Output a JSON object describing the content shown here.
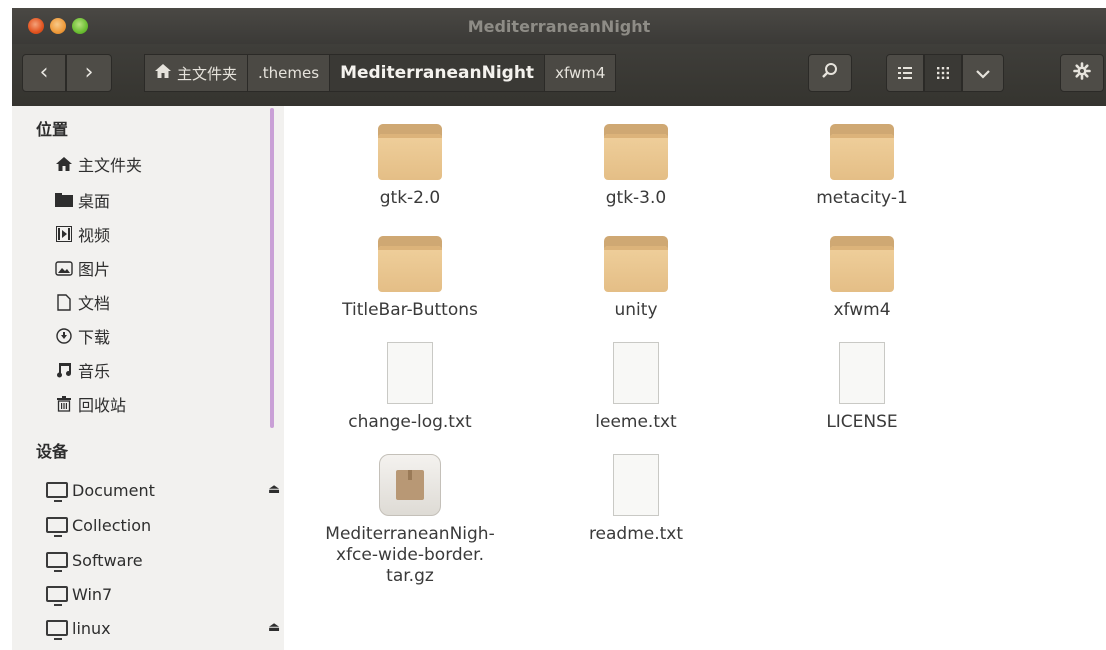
{
  "window": {
    "title": "MediterraneanNight"
  },
  "toolbar": {
    "back_glyph": "‹",
    "forward_glyph": "›",
    "breadcrumbs": [
      {
        "label": "主文件夹",
        "icon": "home-icon"
      },
      {
        "label": ".themes"
      },
      {
        "label": "MediterraneanNight",
        "active": true
      },
      {
        "label": "xfwm4"
      }
    ],
    "icons": [
      "search-icon",
      "list-view-icon",
      "grid-view-icon",
      "chevron-down-icon",
      "gear-icon"
    ]
  },
  "sidebar": {
    "places_header": "位置",
    "places": [
      {
        "label": "主文件夹",
        "icon": "home-icon"
      },
      {
        "label": "桌面",
        "icon": "desktop-folder-icon"
      },
      {
        "label": "视频",
        "icon": "video-icon"
      },
      {
        "label": "图片",
        "icon": "picture-icon"
      },
      {
        "label": "文档",
        "icon": "document-icon"
      },
      {
        "label": "下载",
        "icon": "download-icon"
      },
      {
        "label": "音乐",
        "icon": "music-icon"
      },
      {
        "label": "回收站",
        "icon": "trash-icon"
      }
    ],
    "devices_header": "设备",
    "devices": [
      {
        "label": "Document",
        "eject": true
      },
      {
        "label": "Collection",
        "eject": false
      },
      {
        "label": "Software",
        "eject": false
      },
      {
        "label": "Win7",
        "eject": false
      },
      {
        "label": "linux",
        "eject": true
      }
    ]
  },
  "files": [
    {
      "name": "gtk-2.0",
      "type": "folder"
    },
    {
      "name": "gtk-3.0",
      "type": "folder"
    },
    {
      "name": "metacity-1",
      "type": "folder"
    },
    {
      "name": "TitleBar-Buttons",
      "type": "folder"
    },
    {
      "name": "unity",
      "type": "folder"
    },
    {
      "name": "xfwm4",
      "type": "folder"
    },
    {
      "name": "change-log.txt",
      "type": "text"
    },
    {
      "name": "leeme.txt",
      "type": "text"
    },
    {
      "name": "LICENSE",
      "type": "text"
    },
    {
      "name_lines": [
        "MediterraneanNigh-",
        "xfce-wide-border.",
        "tar.gz"
      ],
      "type": "archive"
    },
    {
      "name": "readme.txt",
      "type": "text"
    }
  ]
}
